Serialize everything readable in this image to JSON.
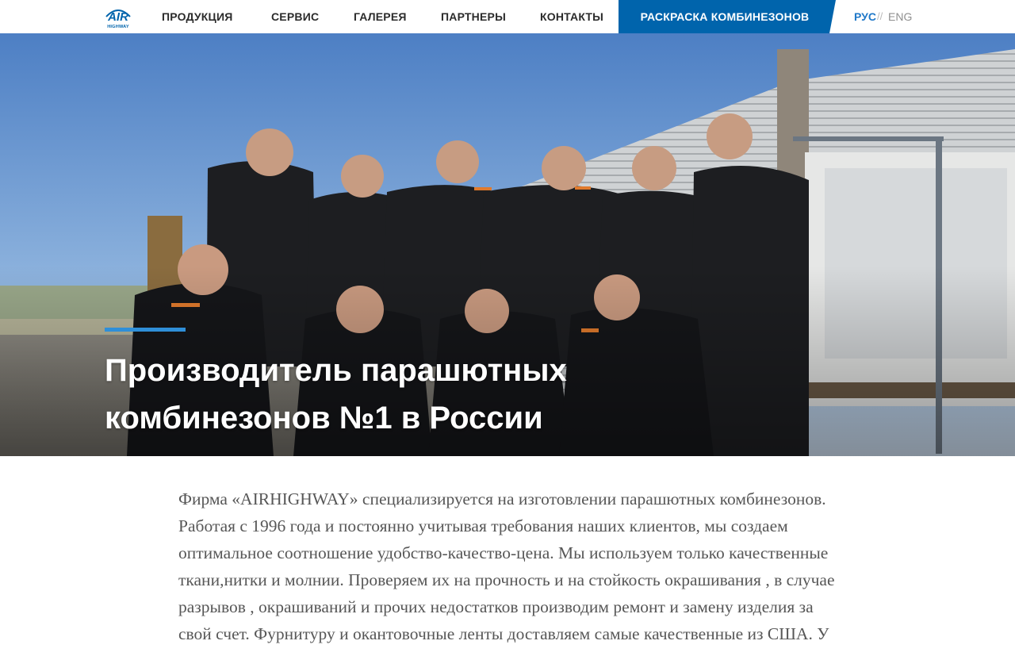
{
  "brand": {
    "logo_text": "AIR",
    "logo_subtext": "HIGHWAY",
    "brand_color": "#005fa8"
  },
  "nav": {
    "items": [
      {
        "label": "ПРОДУКЦИЯ"
      },
      {
        "label": "СЕРВИС"
      },
      {
        "label": "ГАЛЕРЕЯ"
      },
      {
        "label": "ПАРТНЕРЫ"
      },
      {
        "label": "КОНТАКТЫ"
      }
    ],
    "cta_label": "РАСКРАСКА КОМБИНЕЗОНОВ",
    "cta_color": "#0064ac",
    "languages": {
      "active": "РУС",
      "separator": "//",
      "other": "ENG",
      "active_color": "#1f78c8",
      "other_color": "#8f8f8f"
    }
  },
  "hero": {
    "title_line_1": "Производитель парашютных",
    "title_line_2": "комбинезонов №1 в России",
    "accent_color": "#2f8fd8",
    "image_icon": "team-photo"
  },
  "intro": {
    "text": "Фирма «AIRHIGHWAY» специализируется на изготовлении парашютных комбинезонов. Работая с 1996 года и постоянно учитывая требования наших клиентов, мы создаем оптимальное соотношение удобство-качество-цена. Мы используем только качественные ткани,нитки и молнии. Проверяем их на прочность  и  на стойкость окрашивания , в случае разрывов , окрашиваний и прочих недостатков производим ремонт и замену изделия за свой счет. Фурнитуру  и окантовочные  ленты доставляем самые качественные из США. У"
  }
}
